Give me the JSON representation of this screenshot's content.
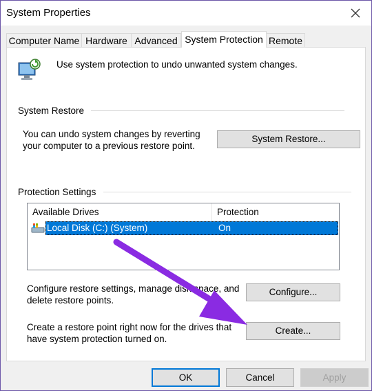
{
  "window": {
    "title": "System Properties"
  },
  "tabs": [
    {
      "label": "Computer Name"
    },
    {
      "label": "Hardware"
    },
    {
      "label": "Advanced"
    },
    {
      "label": "System Protection"
    },
    {
      "label": "Remote"
    }
  ],
  "intro": {
    "text": "Use system protection to undo unwanted system changes."
  },
  "system_restore": {
    "group_title": "System Restore",
    "description_line1": "You can undo system changes by reverting",
    "description_line2": "your computer to a previous restore point.",
    "button_label": "System Restore..."
  },
  "protection": {
    "group_title": "Protection Settings",
    "columns": [
      "Available Drives",
      "Protection"
    ],
    "drives": [
      {
        "name": "Local Disk (C:) (System)",
        "protection": "On"
      }
    ],
    "configure_text_line1": "Configure restore settings, manage disk space, and",
    "configure_text_line2": "delete restore points.",
    "configure_button": "Configure...",
    "create_text_line1": "Create a restore point right now for the drives that",
    "create_text_line2": "have system protection turned on.",
    "create_button": "Create..."
  },
  "footer": {
    "ok": "OK",
    "cancel": "Cancel",
    "apply": "Apply"
  },
  "colors": {
    "accent": "#0078d7",
    "annotation_arrow": "#8a2be2"
  }
}
